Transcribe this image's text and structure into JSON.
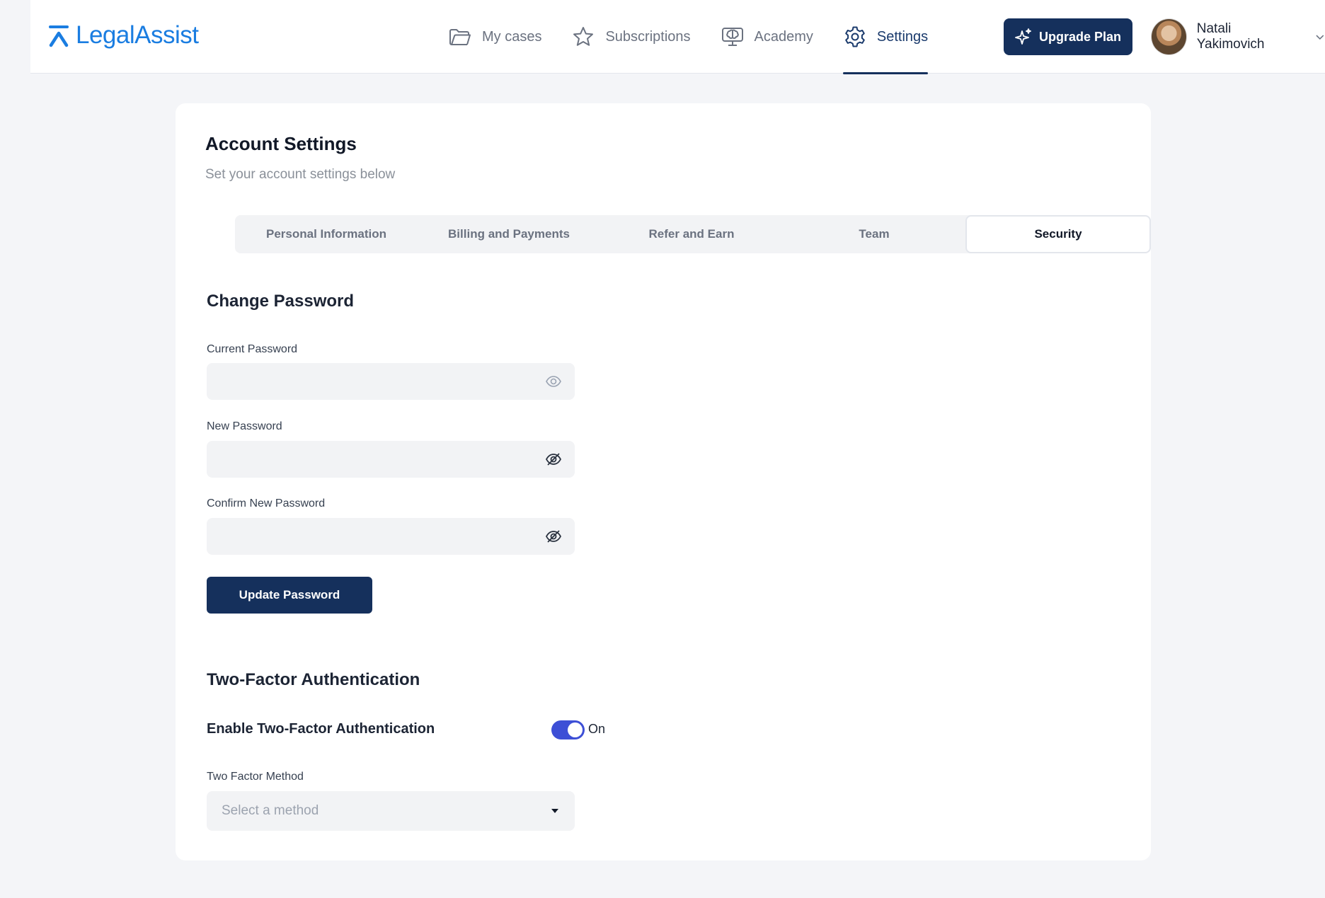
{
  "brand": {
    "name": "LegalAssist",
    "color": "#1a7de1",
    "logo_icon": "legalassist-logo-icon"
  },
  "nav": {
    "items": [
      {
        "label": "My cases",
        "icon": "folder-icon"
      },
      {
        "label": "Subscriptions",
        "icon": "star-icon"
      },
      {
        "label": "Academy",
        "icon": "brain-monitor-icon"
      },
      {
        "label": "Settings",
        "icon": "gear-icon",
        "active": true
      }
    ]
  },
  "header": {
    "upgrade_label": "Upgrade Plan",
    "upgrade_icon": "sparkle-icon",
    "user_name": "Natali Yakimovich"
  },
  "page": {
    "title": "Account Settings",
    "subtitle": "Set your account settings below",
    "tabs": [
      "Personal Information",
      "Billing and Payments",
      "Refer and Earn",
      "Team",
      "Security"
    ],
    "active_tab": "Security"
  },
  "password": {
    "section_title": "Change Password",
    "current_label": "Current Password",
    "current_value": "",
    "new_label": "New Password",
    "new_value": "",
    "confirm_label": "Confirm New Password",
    "confirm_value": "",
    "update_label": "Update Password"
  },
  "twofa": {
    "section_title": "Two-Factor Authentication",
    "enable_label": "Enable Two-Factor Authentication",
    "enabled": true,
    "state_label": "On",
    "method_label": "Two Factor Method",
    "method_placeholder": "Select a method"
  },
  "colors": {
    "primary": "#15305c",
    "toggle_on": "#3d4fd6",
    "accent": "#1a7de1"
  }
}
